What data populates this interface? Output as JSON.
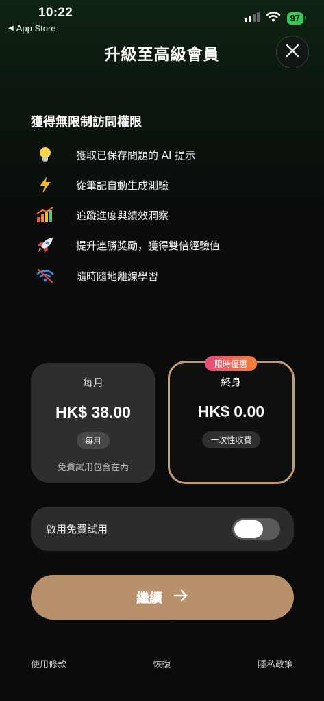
{
  "status_bar": {
    "time": "10:22",
    "back_app": "App Store",
    "battery": "97",
    "icons": [
      "cellular-icon",
      "wifi-icon",
      "battery-icon"
    ]
  },
  "header": {
    "title": "升級至高級會員",
    "close_icon": "close-icon"
  },
  "features": {
    "title": "獲得無限制訪問權限",
    "items": [
      {
        "icon": "lightbulb-icon",
        "label": "獲取已保存問題的 AI 提示"
      },
      {
        "icon": "lightning-icon",
        "label": "從筆記自動生成測驗"
      },
      {
        "icon": "bar-chart-icon",
        "label": "追蹤進度與績效洞察"
      },
      {
        "icon": "rocket-icon",
        "label": "提升連勝獎勵，獲得雙倍經驗值"
      },
      {
        "icon": "offline-wifi-icon",
        "label": "隨時隨地離線學習"
      }
    ]
  },
  "plans": {
    "monthly": {
      "name": "每月",
      "price": "HK$ 38.00",
      "chip": "每月",
      "note": "免費試用包含在內"
    },
    "lifetime": {
      "badge": "限時優惠",
      "name": "終身",
      "price": "HK$ 0.00",
      "chip": "一次性收費",
      "selected": true
    }
  },
  "trial": {
    "label": "啟用免費試用",
    "enabled": false
  },
  "continue": {
    "label": "繼續",
    "icon": "arrow-right-icon"
  },
  "footer": {
    "terms": "使用條款",
    "restore": "恢復",
    "privacy": "隱私政策"
  },
  "colors": {
    "accent": "#b9906c",
    "selected_border": "#c49a72",
    "badge_start": "#e64a7a",
    "badge_end": "#f2803a",
    "battery": "#34c759"
  }
}
